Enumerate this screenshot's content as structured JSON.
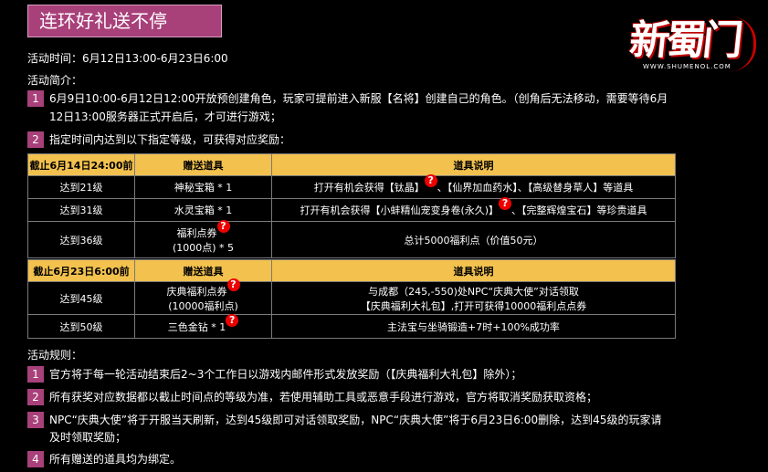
{
  "title": "连环好礼送不停",
  "logo": {
    "chars": "新蜀门",
    "url": "WWW.SHUMENOL.COM"
  },
  "activity_time": "活动时间：6月12日13:00-6月23日6:00",
  "intro_heading": "活动简介：",
  "intro_items": [
    {
      "num": "1",
      "line1": "6月9日10:00-6月12日12:00开放预创建角色，玩家可提前进入新服【名将】创建自己的角色。（创角后无法移动，需要等待6月",
      "line2": "12日13:00服务器正式开启后，才可进行游戏；"
    },
    {
      "num": "2",
      "line1": "指定时间内达到以下指定等级，可获得对应奖励："
    }
  ],
  "table1": {
    "header": [
      "截止6月14日24:00前",
      "赠送道具",
      "道具说明"
    ],
    "rows": [
      {
        "level": "达到21级",
        "item": "神秘宝箱 * 1",
        "desc_a": "打开有机会获得【钛晶】",
        "desc_b": "、【仙界加血药水】、【高级替身草人】等道具"
      },
      {
        "level": "达到31级",
        "item": "水灵宝箱 * 1",
        "desc_a": "打开有机会获得【小蚌精仙宠变身卷(永久)】",
        "desc_b": "、【完整辉煌宝石】等珍贵道具"
      },
      {
        "level": "达到36级",
        "item1": "福利点券",
        "item2": "(1000点) * 5",
        "desc": "总计5000福利点（价值50元）"
      }
    ]
  },
  "table2": {
    "header": [
      "截止6月23日6:00前",
      "赠送道具",
      "道具说明"
    ],
    "rows": [
      {
        "level": "达到45级",
        "item1": "庆典福利点券",
        "item2": "(10000福利点)",
        "desc1": "与成都（245,-550)处NPC“庆典大使”对话领取",
        "desc2": "【庆典福利大礼包】,打开可获得10000福利点点券"
      },
      {
        "level": "达到50级",
        "item": "三色金钻 * 1",
        "desc": "主法宝与坐骑锻造+7时+100%成功率"
      }
    ]
  },
  "rules_heading": "活动规则：",
  "rules": [
    {
      "num": "1",
      "line1": "官方将于每一轮活动结束后2~3个工作日以游戏内邮件形式发放奖励（【庆典福利大礼包】除外）；"
    },
    {
      "num": "2",
      "line1": "所有获奖对应数据都以截止时间点的等级为准，若使用辅助工具或恶意手段进行游戏，官方将取消奖励获取资格；"
    },
    {
      "num": "3",
      "line1": "NPC“庆典大使”将于开服当天刷新，达到45级即可对话领取奖励，NPC“庆典大使”将于6月23日6:00删除，达到45级的玩家请",
      "line2": "及时领取奖励；"
    },
    {
      "num": "4",
      "line1": "所有赠送的道具均为绑定。"
    }
  ],
  "help_mark": "?",
  "colors": {
    "accent": "#a8407a",
    "table_header": "#f2c14e",
    "help_icon": "#e00000"
  }
}
